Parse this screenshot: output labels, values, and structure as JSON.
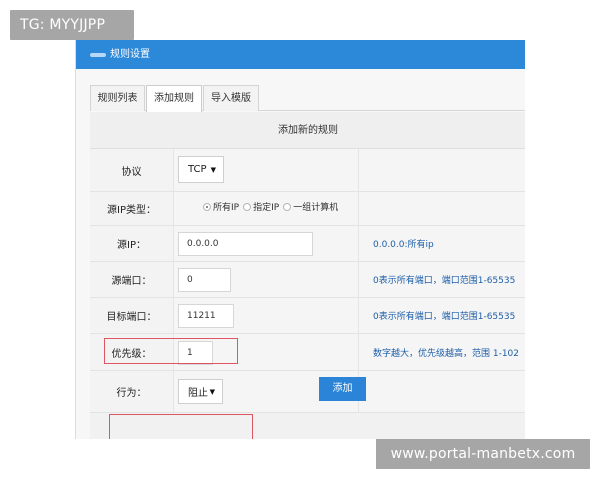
{
  "top_badge": "TG: MYYJJPP",
  "window": {
    "title": "规则设置"
  },
  "tabs": [
    {
      "label": "规则列表"
    },
    {
      "label": "添加规则"
    },
    {
      "label": "导入模版"
    }
  ],
  "form": {
    "title": "添加新的规则",
    "protocol": {
      "label": "协议",
      "value": "TCP"
    },
    "source_ip_type": {
      "label": "源IP类型：",
      "options": [
        "所有IP",
        "指定IP",
        "一组计算机"
      ],
      "selected": "所有IP"
    },
    "source_ip": {
      "label": "源IP：",
      "value": "0.0.0.0",
      "hint": "0.0.0.0:所有ip"
    },
    "source_port": {
      "label": "源端口：",
      "value": "0",
      "hint": "0表示所有端口，端口范围1-65535"
    },
    "target_port": {
      "label": "目标端口：",
      "value": "11211",
      "hint": "0表示所有端口，端口范围1-65535"
    },
    "priority": {
      "label": "优先级：",
      "value": "1",
      "hint": "数字越大，优先级越高，范围 1-102"
    },
    "action": {
      "label": "行为：",
      "value": "阻止"
    },
    "submit_label": "添加"
  },
  "footer_badge": "www.portal-manbetx.com",
  "colors": {
    "titlebar": "#2c88d9",
    "button": "#2b84d8",
    "highlight": "#de5661",
    "hint_text": "#1d5ea8"
  },
  "icons": {
    "dropdown": "chevron-down-icon",
    "radio": "radio-icon"
  }
}
